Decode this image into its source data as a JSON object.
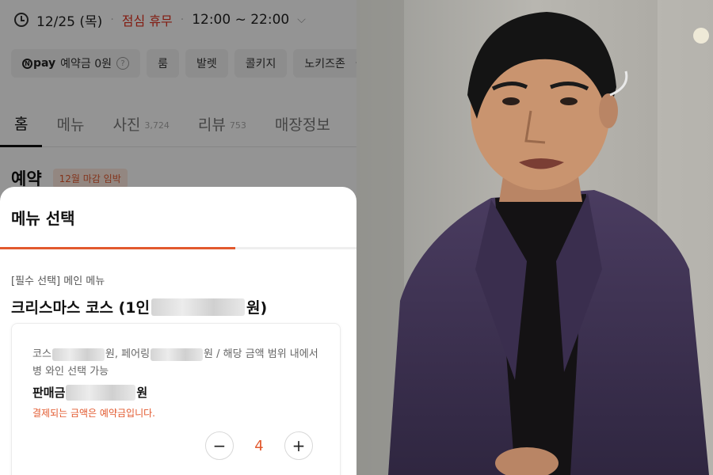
{
  "hours": {
    "date": "12/25 (목)",
    "break": "점심 휴무",
    "time": "12:00 ~ 22:00"
  },
  "chips": [
    {
      "pay_brand": "pay",
      "label": "예약금 0원"
    },
    {
      "label": "룸"
    },
    {
      "label": "발렛"
    },
    {
      "label": "콜키지"
    },
    {
      "label": "노키즈존"
    }
  ],
  "tabs": [
    {
      "label": "홈",
      "count": ""
    },
    {
      "label": "메뉴",
      "count": ""
    },
    {
      "label": "사진",
      "count": "3,724"
    },
    {
      "label": "리뷰",
      "count": "753"
    },
    {
      "label": "매장정보",
      "count": ""
    }
  ],
  "reserve": {
    "title": "예약",
    "badge": "12월 마감 임박"
  },
  "sheet": {
    "title": "메뉴 선택",
    "progress": 0.66,
    "required_label": "[필수 선택] 메인 메뉴",
    "course_prefix": "크리스마스 코스 (1인",
    "course_suffix": "원)",
    "desc_course": "코스",
    "desc_won1": "원, 페어링",
    "desc_won2": "원 / 해당 금액 범위 내에서 병 와인 선택 가능",
    "price_label": "판매금",
    "price_suffix": "원",
    "notice": "결제되는 금액은 예약금입니다.",
    "quantity": "4"
  },
  "colors": {
    "accent": "#e2592e",
    "break_red": "#e0301e",
    "suit": "#3b2f4d"
  }
}
